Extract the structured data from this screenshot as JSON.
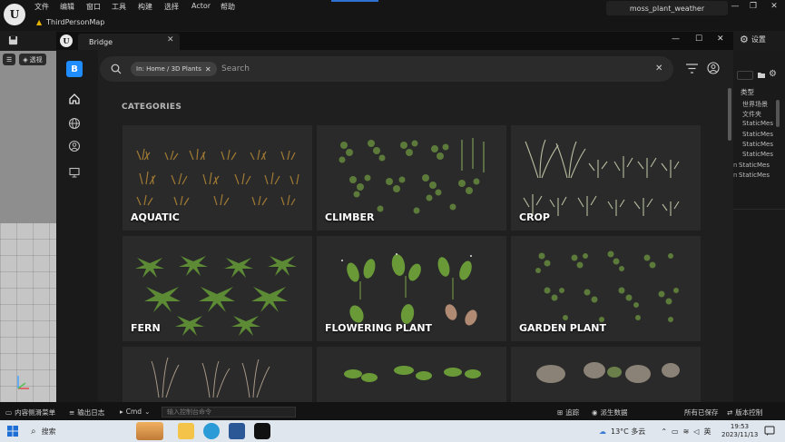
{
  "ue": {
    "logo": "U",
    "menu": [
      "文件",
      "编辑",
      "窗口",
      "工具",
      "构建",
      "选择",
      "Actor",
      "帮助"
    ],
    "map_tab": "ThirdPersonMap",
    "project": "moss_plant_weather",
    "settings_label": "设置",
    "viewport_perspective": "透视",
    "outliner": {
      "type_header": "类型",
      "rows": [
        {
          "marker": "",
          "text": "世界场景"
        },
        {
          "marker": "",
          "text": "文件夹"
        },
        {
          "marker": "",
          "text": "StaticMes"
        },
        {
          "marker": "",
          "text": "StaticMes"
        },
        {
          "marker": "",
          "text": "StaticMes"
        },
        {
          "marker": "",
          "text": "StaticMes"
        },
        {
          "marker": "n",
          "text": "StaticMes"
        },
        {
          "marker": "n",
          "text": "StaticMes"
        }
      ]
    },
    "status": {
      "content_drawer": "内容侧滑菜单",
      "output_log": "输出日志",
      "cmd": "Cmd",
      "console_placeholder": "输入控制台命令",
      "trace": "追踪",
      "derived_data": "派生数据",
      "all_saved": "所有已保存",
      "source_control": "版本控制"
    }
  },
  "bridge": {
    "tab_title": "Bridge",
    "logo": "B",
    "filter_chip": "In: Home / 3D Plants",
    "search_placeholder": "Search",
    "categories_heading": "CATEGORIES",
    "categories": [
      {
        "label": "AQUATIC"
      },
      {
        "label": "CLIMBER"
      },
      {
        "label": "CROP"
      },
      {
        "label": "FERN"
      },
      {
        "label": "FLOWERING PLANT"
      },
      {
        "label": "GARDEN PLANT"
      },
      {
        "label": ""
      },
      {
        "label": ""
      },
      {
        "label": ""
      }
    ]
  },
  "taskbar": {
    "search": "搜索",
    "weather": "13°C 多云",
    "ime": "英",
    "time": "19:53",
    "date": "2023/11/13"
  },
  "colors": {
    "bridge_accent": "#1f8cff",
    "ue_blue": "#2f6fd0",
    "warning": "#e6b400"
  }
}
